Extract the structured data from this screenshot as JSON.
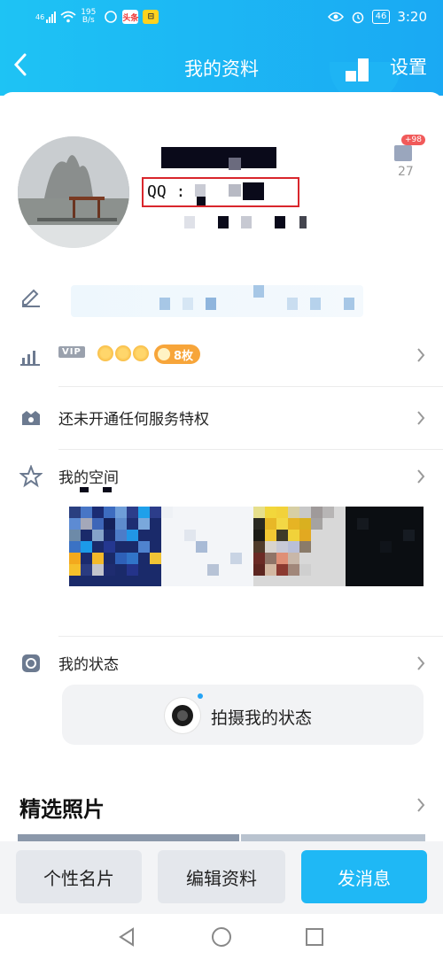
{
  "status_bar": {
    "network": "46",
    "speed_value": "195",
    "speed_unit": "B/s",
    "app_badge": "头条",
    "battery": "46",
    "time": "3:20"
  },
  "header": {
    "title": "我的资料",
    "settings_label": "设置"
  },
  "profile": {
    "qq_label": "QQ :",
    "like_badge": "+98",
    "like_count": "27"
  },
  "rows": {
    "vip_tag": "VIP",
    "badge_count": "8枚",
    "privilege_label": "还未开通任何服务特权",
    "space_label": "我的空间",
    "status_label": "我的状态"
  },
  "status_capture": {
    "label": "拍摄我的状态"
  },
  "photos": {
    "title": "精选照片"
  },
  "actions": {
    "card_label": "个性名片",
    "edit_label": "编辑资料",
    "message_label": "发消息"
  },
  "colors": {
    "header_start": "#1ec3f4",
    "header_end": "#1aa9f3",
    "accent_blue": "#1fb8f5",
    "highlight_red": "#d9262c",
    "badge_orange": "#f7a53a"
  }
}
